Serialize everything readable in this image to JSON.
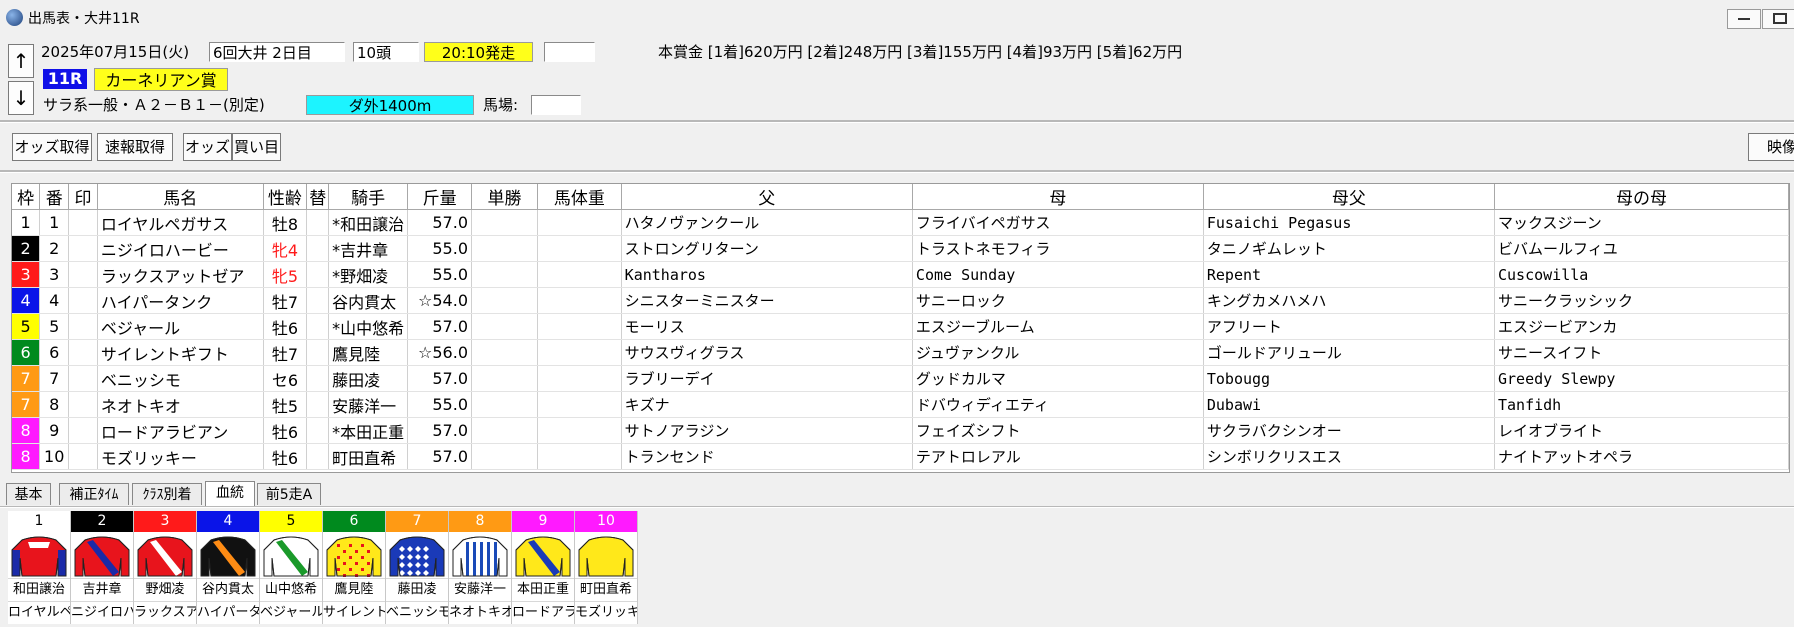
{
  "window": {
    "title": "出馬表・大井11R"
  },
  "race": {
    "date": "2025年07月15日(火)",
    "meeting": "6回大井 2日目",
    "runners": "10頭",
    "post_time": "20:10発走",
    "number": "11R",
    "name": "カーネリアン賞",
    "class": "サラ系一般・Ａ２－Ｂ１－(別定)",
    "course": "ダ外1400m",
    "going_label": "馬場:",
    "going_value": "",
    "extra_field": "",
    "prize": "本賞金 [1着]620万円 [2着]248万円 [3着]155万円 [4着]93万円 [5着]62万円"
  },
  "nav": {
    "up": "↑",
    "down": "↓"
  },
  "toolbar": {
    "odds_fetch": "オッズ取得",
    "results_fetch": "速報取得",
    "odds": "オッズ",
    "bets": "買い目",
    "video": "映像"
  },
  "columns": [
    "枠",
    "番",
    "印",
    "馬名",
    "性齢",
    "替",
    "騎手",
    "斤量",
    "単勝",
    "馬体重",
    "父",
    "母",
    "母父",
    "母の母"
  ],
  "frame_colors": {
    "1": {
      "bg": "#ffffff",
      "fg": "#000000"
    },
    "2": {
      "bg": "#000000",
      "fg": "#ffffff"
    },
    "3": {
      "bg": "#ff1a1a",
      "fg": "#ffffff"
    },
    "4": {
      "bg": "#0a14e8",
      "fg": "#ffffff"
    },
    "5": {
      "bg": "#ffff00",
      "fg": "#000000"
    },
    "6": {
      "bg": "#008a1e",
      "fg": "#ffffff"
    },
    "7": {
      "bg": "#ff9a14",
      "fg": "#ffffff"
    },
    "8": {
      "bg": "#ff1aff",
      "fg": "#ffffff"
    }
  },
  "entries": [
    {
      "frame": "1",
      "num": "1",
      "mark": "",
      "horse": "ロイヤルペガサス",
      "sexage": "牡8",
      "female": false,
      "change": "",
      "jockey": "*和田譲治",
      "weight": "57.0",
      "odds": "",
      "body": "",
      "sire": "ハタノヴァンクール",
      "dam": "フライバイペガサス",
      "damsire": "Fusaichi Pegasus",
      "granddam": "マックスジーン"
    },
    {
      "frame": "2",
      "num": "2",
      "mark": "",
      "horse": "ニジイロハービー",
      "sexage": "牝4",
      "female": true,
      "change": "",
      "jockey": "*吉井章",
      "weight": "55.0",
      "odds": "",
      "body": "",
      "sire": "ストロングリターン",
      "dam": "トラストネモフィラ",
      "damsire": "タニノギムレット",
      "granddam": "ビバムールフィユ"
    },
    {
      "frame": "3",
      "num": "3",
      "mark": "",
      "horse": "ラックスアットゼア",
      "sexage": "牝5",
      "female": true,
      "change": "",
      "jockey": "*野畑凌",
      "weight": "55.0",
      "odds": "",
      "body": "",
      "sire": "Kantharos",
      "dam": "Come Sunday",
      "damsire": "Repent",
      "granddam": "Cuscowilla"
    },
    {
      "frame": "4",
      "num": "4",
      "mark": "",
      "horse": "ハイパータンク",
      "sexage": "牡7",
      "female": false,
      "change": "",
      "jockey": "谷内貫太",
      "weight": "☆54.0",
      "odds": "",
      "body": "",
      "sire": "シニスターミニスター",
      "dam": "サニーロック",
      "damsire": "キングカメハメハ",
      "granddam": "サニークラッシック"
    },
    {
      "frame": "5",
      "num": "5",
      "mark": "",
      "horse": "ベジャール",
      "sexage": "牡6",
      "female": false,
      "change": "",
      "jockey": "*山中悠希",
      "weight": "57.0",
      "odds": "",
      "body": "",
      "sire": "モーリス",
      "dam": "エスジーブルーム",
      "damsire": "アフリート",
      "granddam": "エスジービアンカ"
    },
    {
      "frame": "6",
      "num": "6",
      "mark": "",
      "horse": "サイレントギフト",
      "sexage": "牡7",
      "female": false,
      "change": "",
      "jockey": "鷹見陸",
      "weight": "☆56.0",
      "odds": "",
      "body": "",
      "sire": "サウスヴィグラス",
      "dam": "ジュヴァンクル",
      "damsire": "ゴールドアリュール",
      "granddam": "サニースイフト"
    },
    {
      "frame": "7",
      "num": "7",
      "mark": "",
      "horse": "ベニッシモ",
      "sexage": "セ6",
      "female": false,
      "change": "",
      "jockey": "藤田凌",
      "weight": "57.0",
      "odds": "",
      "body": "",
      "sire": "ラブリーデイ",
      "dam": "グッドカルマ",
      "damsire": "Tobougg",
      "granddam": "Greedy Slewpy"
    },
    {
      "frame": "7",
      "num": "8",
      "mark": "",
      "horse": "ネオトキオ",
      "sexage": "牡5",
      "female": false,
      "change": "",
      "jockey": "安藤洋一",
      "weight": "55.0",
      "odds": "",
      "body": "",
      "sire": "キズナ",
      "dam": "ドバウィディエティ",
      "damsire": "Dubawi",
      "granddam": "Tanfidh"
    },
    {
      "frame": "8",
      "num": "9",
      "mark": "",
      "horse": "ロードアラビアン",
      "sexage": "牡6",
      "female": false,
      "change": "",
      "jockey": "*本田正重",
      "weight": "57.0",
      "odds": "",
      "body": "",
      "sire": "サトノアラジン",
      "dam": "フェイズシフト",
      "damsire": "サクラバクシンオー",
      "granddam": "レイオブライト"
    },
    {
      "frame": "8",
      "num": "10",
      "mark": "",
      "horse": "モズリッキー",
      "sexage": "牡6",
      "female": false,
      "change": "",
      "jockey": "町田直希",
      "weight": "57.0",
      "odds": "",
      "body": "",
      "sire": "トランセンド",
      "dam": "テアトロレアル",
      "damsire": "シンボリクリスエス",
      "granddam": "ナイトアットオペラ"
    }
  ],
  "tabs": [
    "基本",
    "補正ﾀｲﾑ",
    "ｸﾗｽ別着",
    "血統",
    "前5走A"
  ],
  "active_tab": 3,
  "silks": [
    {
      "num": "1",
      "jockey": "和田譲治",
      "horse": "ロイヤルペ",
      "pattern": "red-blue-sleeves"
    },
    {
      "num": "2",
      "jockey": "吉井章",
      "horse": "ニジイロハ",
      "pattern": "red-blue-sash"
    },
    {
      "num": "3",
      "jockey": "野畑凌",
      "horse": "ラックスア",
      "pattern": "red-white-sash"
    },
    {
      "num": "4",
      "jockey": "谷内貫太",
      "horse": "ハイパータ",
      "pattern": "black-orange-sash"
    },
    {
      "num": "5",
      "jockey": "山中悠希",
      "horse": "ベジャール",
      "pattern": "white-green-sash"
    },
    {
      "num": "6",
      "jockey": "鷹見陸",
      "horse": "サイレント",
      "pattern": "yellow-red-checks"
    },
    {
      "num": "7",
      "jockey": "藤田凌",
      "horse": "ベニッシモ",
      "pattern": "blue-white-diamonds"
    },
    {
      "num": "8",
      "jockey": "安藤洋一",
      "horse": "ネオトキオ",
      "pattern": "white-blue-stripes"
    },
    {
      "num": "9",
      "jockey": "本田正重",
      "horse": "ロードアラ",
      "pattern": "yellow-blue-sash"
    },
    {
      "num": "10",
      "jockey": "町田直希",
      "horse": "モズリッキ",
      "pattern": "yellow-plain"
    }
  ]
}
